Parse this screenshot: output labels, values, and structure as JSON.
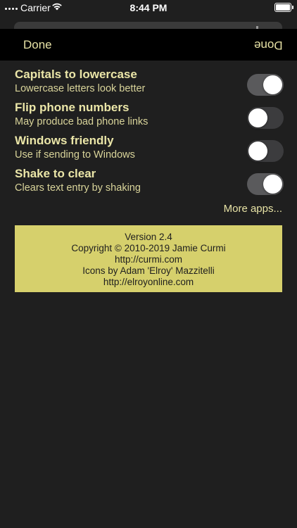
{
  "status_bar": {
    "carrier": "Carrier",
    "time": "8:44 PM"
  },
  "nav": {
    "done_left": "Done",
    "done_right": "Done"
  },
  "settings": [
    {
      "title": "Capitals to lowercase",
      "subtitle": "Lowercase letters look better",
      "on": true
    },
    {
      "title": "Flip phone numbers",
      "subtitle": "May produce bad phone links",
      "on": false
    },
    {
      "title": "Windows friendly",
      "subtitle": "Use if sending to Windows",
      "on": false
    },
    {
      "title": "Shake to clear",
      "subtitle": "Clears text entry by shaking",
      "on": true
    }
  ],
  "more_apps": "More apps...",
  "about": {
    "version": "Version 2.4",
    "copyright": "Copyright © 2010-2019 Jamie Curmi",
    "url1": "http://curmi.com",
    "icons_credit": "Icons by Adam 'Elroy' Mazzitelli",
    "url2": "http://elroyonline.com"
  },
  "colors": {
    "accent": "#e8e3a6",
    "about_bg": "#d6d06c",
    "background": "#1f1f1f"
  }
}
